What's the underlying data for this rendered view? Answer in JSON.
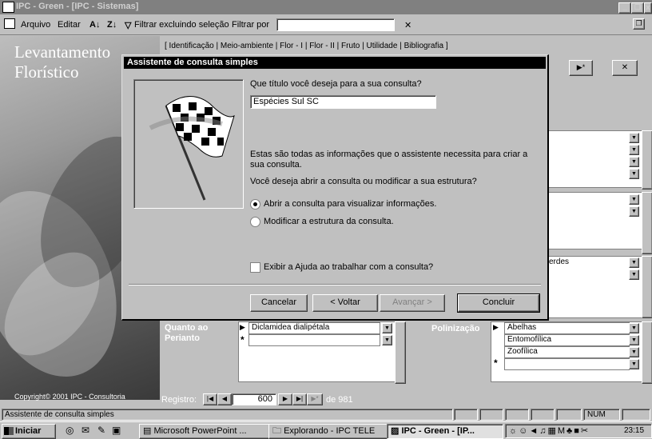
{
  "window": {
    "title": "IPC - Green - [IPC - Sistemas]"
  },
  "menu": {
    "arquivo": "Arquivo",
    "editar": "Editar",
    "filtrar_excluindo": "Filtrar excluindo seleção",
    "filtrar_por": "Filtrar por"
  },
  "background": {
    "title_line1": "Levantamento",
    "title_line2": "Florístico",
    "copyright": "Copyright© 2001  IPC - Consultoria"
  },
  "tabs_text": "[ Identificação | Meio-ambiente |  Flor - I |  Flor - II |  Fruto |  Utilidade |  Bibliografia ]",
  "form": {
    "quanto_ao_perianto_label": "Quanto ao Perianto",
    "perianto_value": "Diclamidea dialipétala",
    "polinizacao_label": "Polinização",
    "polinizacao_values": [
      "Abelhas",
      "Entomofílica",
      "Zoofílica"
    ],
    "verdes_value": "erdes",
    "registro_label": "Registro:",
    "registro_value": "600",
    "registro_total": "de  981"
  },
  "dialog": {
    "title": "Assistente de consulta simples",
    "question": "Que título você deseja para a sua consulta?",
    "query_title_value": "Espécies Sul SC",
    "info_text": "Estas são todas as informações que o assistente necessita para criar a sua consulta.",
    "choice_text": "Você deseja abrir a consulta ou modificar a sua estrutura?",
    "option_open": "Abrir a consulta para visualizar informações.",
    "option_modify": "Modificar a estrutura da consulta.",
    "help_checkbox": "Exibir a Ajuda ao trabalhar com a consulta?",
    "selected_option": "open",
    "buttons": {
      "cancel": "Cancelar",
      "back": "< Voltar",
      "next": "Avançar >",
      "finish": "Concluir"
    }
  },
  "statusbar": {
    "text": "Assistente de consulta simples",
    "num": "NUM"
  },
  "taskbar": {
    "start": "Iniciar",
    "tasks": [
      "Microsoft PowerPoint ...",
      "Explorando - IPC TELE",
      "IPC - Green - [IP..."
    ],
    "clock": "23:15"
  }
}
